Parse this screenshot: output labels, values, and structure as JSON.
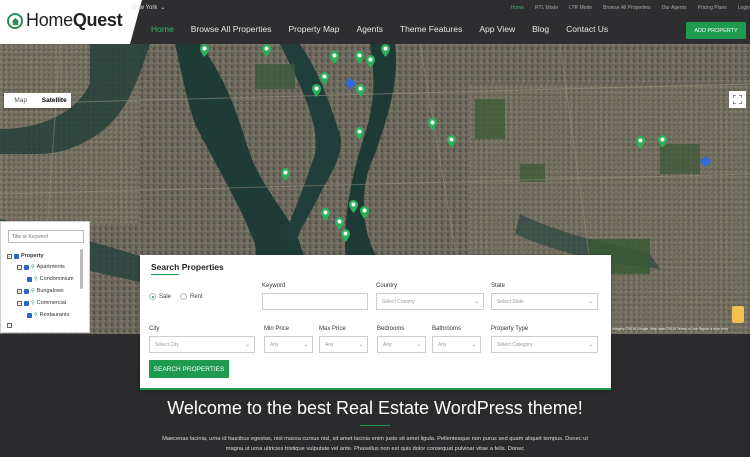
{
  "header": {
    "logo": {
      "first": "Home",
      "second": "Quest"
    },
    "city_select": "New York",
    "top_links": [
      "Home",
      "RTL Mode",
      "LTR Mode",
      "Browse All Properties",
      "Our Agents",
      "Pricing Plans",
      "Login"
    ],
    "nav": [
      "Home",
      "Browse All Properties",
      "Property Map",
      "Agents",
      "Theme Features",
      "App View",
      "Blog",
      "Contact Us"
    ],
    "add_property": "ADD PROPERTY",
    "accent": "#1f9b4f"
  },
  "map": {
    "type_map": "Map",
    "type_satellite": "Satellite",
    "zoom_in": "+",
    "zoom_out": "−",
    "attribution": "Imagery ©2018 Google, Map data ©2018   Terms of Use   Report a map error"
  },
  "filter_tree": {
    "placeholder": "Title or Keyword",
    "root": "Property",
    "items": [
      "Apartments",
      "Condominium",
      "Bungalows",
      "Commercial",
      "Restaurants"
    ]
  },
  "search": {
    "title": "Search Properties",
    "sale": "Sale",
    "rent": "Rent",
    "keyword_label": "Keyword",
    "country_label": "Country",
    "country_value": "Select Country",
    "state_label": "State",
    "state_value": "Select State",
    "city_label": "City",
    "city_value": "Select City",
    "min_price_label": "Min Price",
    "min_price_value": "Any",
    "max_price_label": "Max Price",
    "max_price_value": "Any",
    "bedrooms_label": "Bedrooms",
    "bedrooms_value": "Any",
    "bathrooms_label": "Bathrooms",
    "bathrooms_value": "Any",
    "type_label": "Property Type",
    "type_value": "Select Category",
    "button": "SEARCH PROPERTIES"
  },
  "welcome": {
    "title": "Welcome to the best Real Estate WordPress theme!",
    "text": "Maecenas lacinia, urna id faucibus egestas, nisl massa cursus nisl, sit amet lacinia enim justo sit amet ligula. Pellentesque non purus sed quam aliquet tempus. Donec ut magna ut urna ultricies tristique vulputate vel ante. Phasellus non est quis dolor consequat pulvinar vitae a felis. Donec"
  }
}
